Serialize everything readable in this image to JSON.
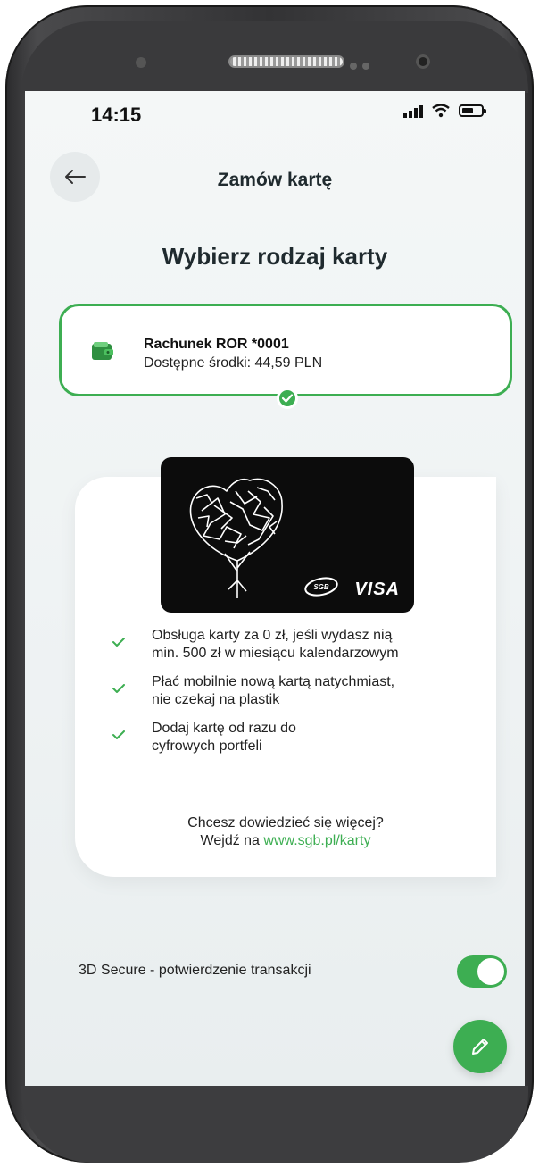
{
  "status_bar": {
    "time": "14:15",
    "signal_icon": "signal-icon",
    "wifi_icon": "wifi-icon",
    "battery_icon": "battery-icon"
  },
  "header": {
    "back_icon": "arrow-left-icon",
    "title": "Zamów kartę"
  },
  "main": {
    "heading": "Wybierz rodzaj karty",
    "account": {
      "name": "Rachunek ROR *0001",
      "balance": "Dostępne środki: 44,59 PLN",
      "icon": "wallet-icon",
      "selected": true
    },
    "card": {
      "brand": "VISA",
      "issuer_logo": "sgb-logo",
      "art": "heart-tree-art"
    },
    "benefits": [
      {
        "line1": "Obsługa karty za 0 zł, jeśli wydasz nią",
        "line2": "min. 500 zł w miesiącu kalendarzowym"
      },
      {
        "line1": "Płać mobilnie nową kartą natychmiast,",
        "line2": "nie czekaj na plastik"
      },
      {
        "line1": "Dodaj kartę od razu do",
        "line2": "cyfrowych portfeli"
      }
    ],
    "more_info": {
      "question": "Chcesz dowiedzieć się więcej?",
      "prefix": "Wejdź na ",
      "link": "www.sgb.pl/karty"
    },
    "secure": {
      "label": "3D Secure - potwierdzenie transakcji",
      "enabled": true
    },
    "fab_icon": "pencil-icon"
  },
  "colors": {
    "accent": "#3dae52",
    "text": "#1f2a2e",
    "background": "#eef2f3"
  }
}
